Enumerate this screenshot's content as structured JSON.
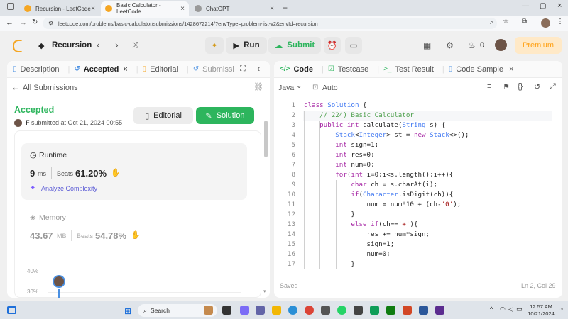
{
  "browser": {
    "tabs": [
      {
        "title": "Recursion - LeetCode",
        "active": false
      },
      {
        "title": "Basic Calculator - LeetCode",
        "active": true
      },
      {
        "title": "ChatGPT",
        "active": false
      }
    ],
    "url": "leetcode.com/problems/basic-calculator/submissions/1428672214/?envType=problem-list-v2&envId=recursion"
  },
  "header": {
    "problem_list": "Recursion",
    "run": "Run",
    "submit": "Submit",
    "streak": "0",
    "premium": "Premium"
  },
  "left": {
    "tabs": [
      "Description",
      "Accepted",
      "Editorial",
      "Submissi"
    ],
    "all_submissions": "All Submissions",
    "status": "Accepted",
    "user_initial": "F",
    "submitted": "submitted at Oct 21, 2024 00:55",
    "editorial_btn": "Editorial",
    "solution_btn": "Solution",
    "runtime": {
      "label": "Runtime",
      "value": "9",
      "unit": "ms",
      "beats_label": "Beats",
      "beats": "61.20%"
    },
    "analyze": "Analyze Complexity",
    "memory": {
      "label": "Memory",
      "value": "43.67",
      "unit": "MB",
      "beats_label": "Beats",
      "beats": "54.78%"
    },
    "chart": {
      "ticks": [
        "40%",
        "30%"
      ]
    }
  },
  "right": {
    "tabs": [
      "Code",
      "Testcase",
      "Test Result",
      "Code Sample"
    ],
    "language": "Java",
    "auto": "Auto",
    "status": "Saved",
    "cursor": "Ln 2, Col 29",
    "lines": [
      "class Solution {",
      "    // 224) Basic Calculator",
      "    public int calculate(String s) {",
      "        Stack<Integer> st = new Stack<>();",
      "        int sign=1;",
      "        int res=0;",
      "        int num=0;",
      "        for(int i=0;i<s.length();i++){",
      "            char ch = s.charAt(i);",
      "            if(Character.isDigit(ch)){",
      "                num = num*10 + (ch-'0');",
      "            }",
      "            else if(ch=='+'){",
      "                res += num*sign;",
      "                sign=1;",
      "                num=0;",
      "            }"
    ]
  },
  "taskbar": {
    "search": "Search",
    "time": "12:57 AM",
    "date": "10/21/2024"
  },
  "colors": {
    "accent_green": "#2db55d",
    "premium": "#ffa116",
    "accepted": "#2db55d"
  }
}
